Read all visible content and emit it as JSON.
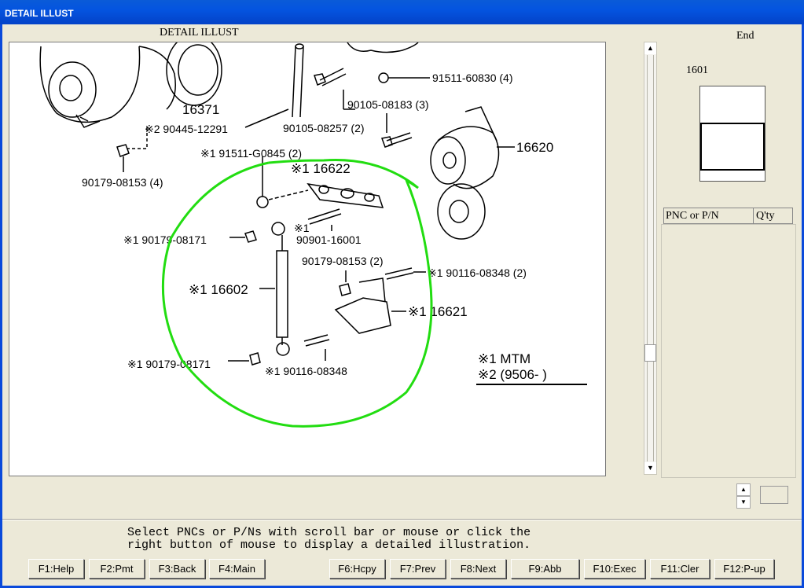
{
  "window": {
    "title": "DETAIL ILLUST"
  },
  "illustration": {
    "title": "DETAIL ILLUST",
    "labels": {
      "p91511_60830": "91511-60830 (4)",
      "p90105_08183": "90105-08183 (3)",
      "p16371": "16371",
      "p90445": "※2 90445-12291",
      "p90105_08257": "90105-08257 (2)",
      "p16620": "16620",
      "p91511_g0845": "※1 91511-G0845 (2)",
      "p90179_08153_4": "90179-08153 (4)",
      "p116622": "※1 16622",
      "p90179_08171_a": "※1 90179-08171",
      "p90901": "90901-16001",
      "p90901_mark": "※1",
      "p90179_08153_2": "90179-08153 (2)",
      "p90116_08348_2": "※1 90116-08348 (2)",
      "p116602": "※1 16602",
      "p116621": "※1 16621",
      "p90179_08171_b": "※1 90179-08171",
      "p90116_08348": "※1 90116-08348",
      "note1": "※1 MTM",
      "note2": "※2 (9506-      )"
    }
  },
  "side": {
    "end_label": "End",
    "page_number": "1601",
    "table_headers": [
      "PNC or P/N",
      "Q'ty"
    ]
  },
  "status_message": "Select PNCs or P/Ns with scroll bar or mouse or click the\nright button of mouse to display a detailed illustration.",
  "function_keys": [
    {
      "key": "F1",
      "label": "F1:Help"
    },
    {
      "key": "F2",
      "label": "F2:Pmt"
    },
    {
      "key": "F3",
      "label": "F3:Back"
    },
    {
      "key": "F4",
      "label": "F4:Main"
    },
    {
      "key": "F6",
      "label": "F6:Hcpy"
    },
    {
      "key": "F7",
      "label": "F7:Prev"
    },
    {
      "key": "F8",
      "label": "F8:Next"
    },
    {
      "key": "F9",
      "label": "F9:Abb"
    },
    {
      "key": "F10",
      "label": "F10:Exec"
    },
    {
      "key": "F11",
      "label": "F11:Cler"
    },
    {
      "key": "F12",
      "label": "F12:P-up"
    }
  ],
  "colors": {
    "titlebar": "#0A5BD8",
    "highlight_circle": "#22DD11",
    "background": "#ECE9D8"
  }
}
